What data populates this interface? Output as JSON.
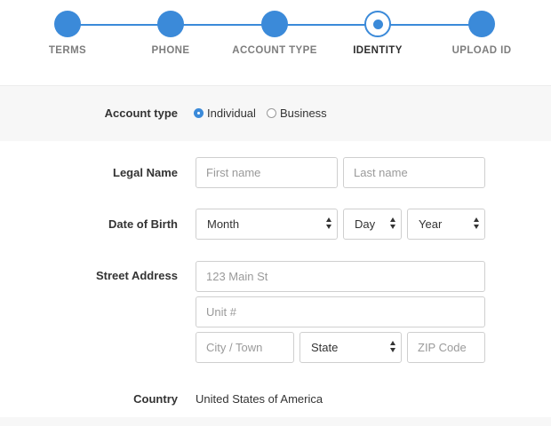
{
  "stepper": {
    "steps": [
      {
        "label": "TERMS",
        "state": "done"
      },
      {
        "label": "PHONE",
        "state": "done"
      },
      {
        "label": "ACCOUNT TYPE",
        "state": "done"
      },
      {
        "label": "IDENTITY",
        "state": "active"
      },
      {
        "label": "UPLOAD ID",
        "state": "done"
      }
    ],
    "accent_color": "#3b8ad9"
  },
  "account_type": {
    "label": "Account type",
    "options": [
      {
        "label": "Individual",
        "checked": true
      },
      {
        "label": "Business",
        "checked": false
      }
    ]
  },
  "legal_name": {
    "label": "Legal Name",
    "first_placeholder": "First name",
    "last_placeholder": "Last name"
  },
  "dob": {
    "label": "Date of Birth",
    "month": "Month",
    "day": "Day",
    "year": "Year"
  },
  "address": {
    "label": "Street Address",
    "street_placeholder": "123 Main St",
    "unit_placeholder": "Unit #",
    "city_placeholder": "City / Town",
    "state": "State",
    "zip_placeholder": "ZIP Code"
  },
  "country": {
    "label": "Country",
    "value": "United States of America"
  }
}
